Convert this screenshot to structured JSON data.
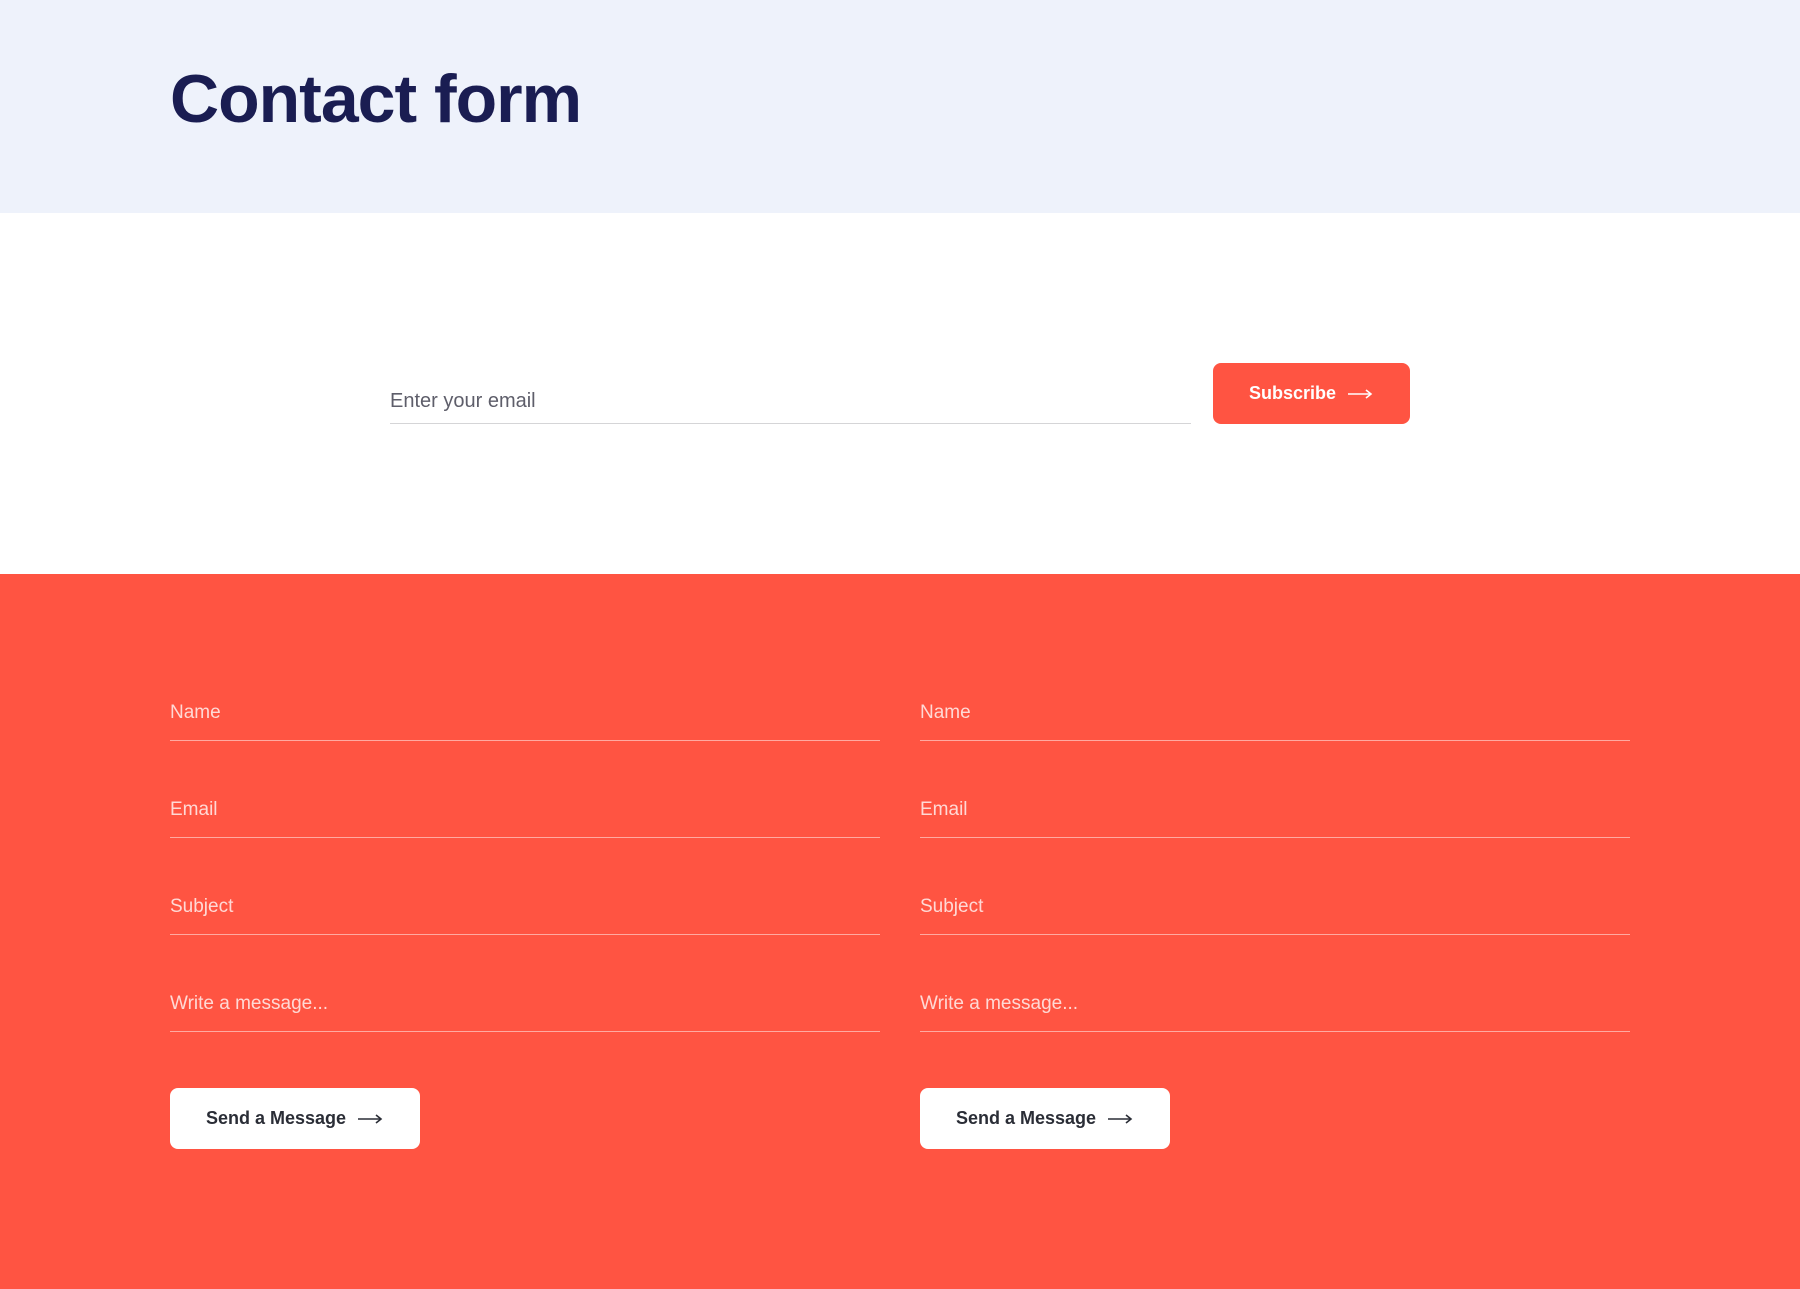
{
  "hero": {
    "title": "Contact form"
  },
  "subscribe": {
    "email_placeholder": "Enter your email",
    "button_label": "Subscribe"
  },
  "contact_forms": {
    "left": {
      "name_placeholder": "Name",
      "email_placeholder": "Email",
      "subject_placeholder": "Subject",
      "message_placeholder": "Write a message...",
      "send_label": "Send a Message"
    },
    "right": {
      "name_placeholder": "Name",
      "email_placeholder": "Email",
      "subject_placeholder": "Subject",
      "message_placeholder": "Write a message...",
      "send_label": "Send a Message"
    }
  },
  "colors": {
    "accent": "#ff5442",
    "title": "#1a1d52",
    "hero_bg": "#eef2fb"
  }
}
